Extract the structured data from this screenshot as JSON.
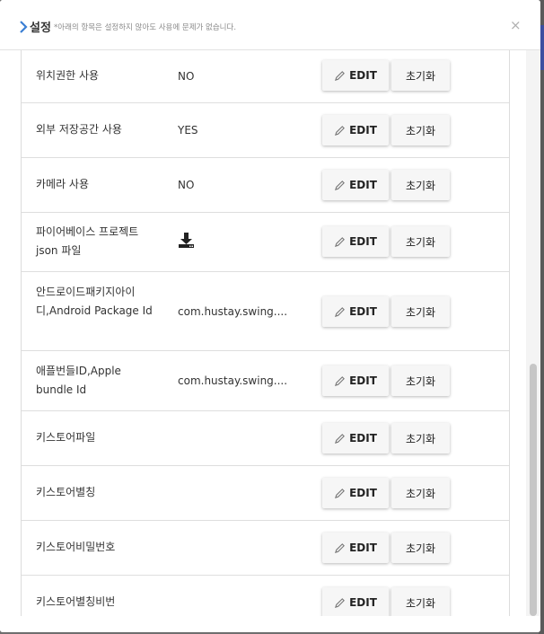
{
  "header": {
    "title": "설정",
    "subtitle": "*아래의 항목은 설정하지 않아도 사용에 문제가 없습니다.",
    "close_label": "×"
  },
  "buttons": {
    "edit_label": "EDIT",
    "reset_label": "초기화"
  },
  "rows": [
    {
      "label": "위치권한 사용",
      "value": "NO"
    },
    {
      "label": "외부 저장공간 사용",
      "value": "YES"
    },
    {
      "label": "카메라 사용",
      "value": "NO"
    },
    {
      "label": "파이어베이스 프로젝트 json 파일",
      "value": "",
      "icon": "download-icon"
    },
    {
      "label": "안드로이드패키지아이디,Android Package Id",
      "value": "com.hustay.swing...."
    },
    {
      "label": "애플번들ID,Apple bundle Id",
      "value": "com.hustay.swing...."
    },
    {
      "label": "키스토어파일",
      "value": ""
    },
    {
      "label": "키스토어별칭",
      "value": ""
    },
    {
      "label": "키스토어비밀번호",
      "value": ""
    },
    {
      "label": "키스토어별칭비번",
      "value": ""
    }
  ]
}
